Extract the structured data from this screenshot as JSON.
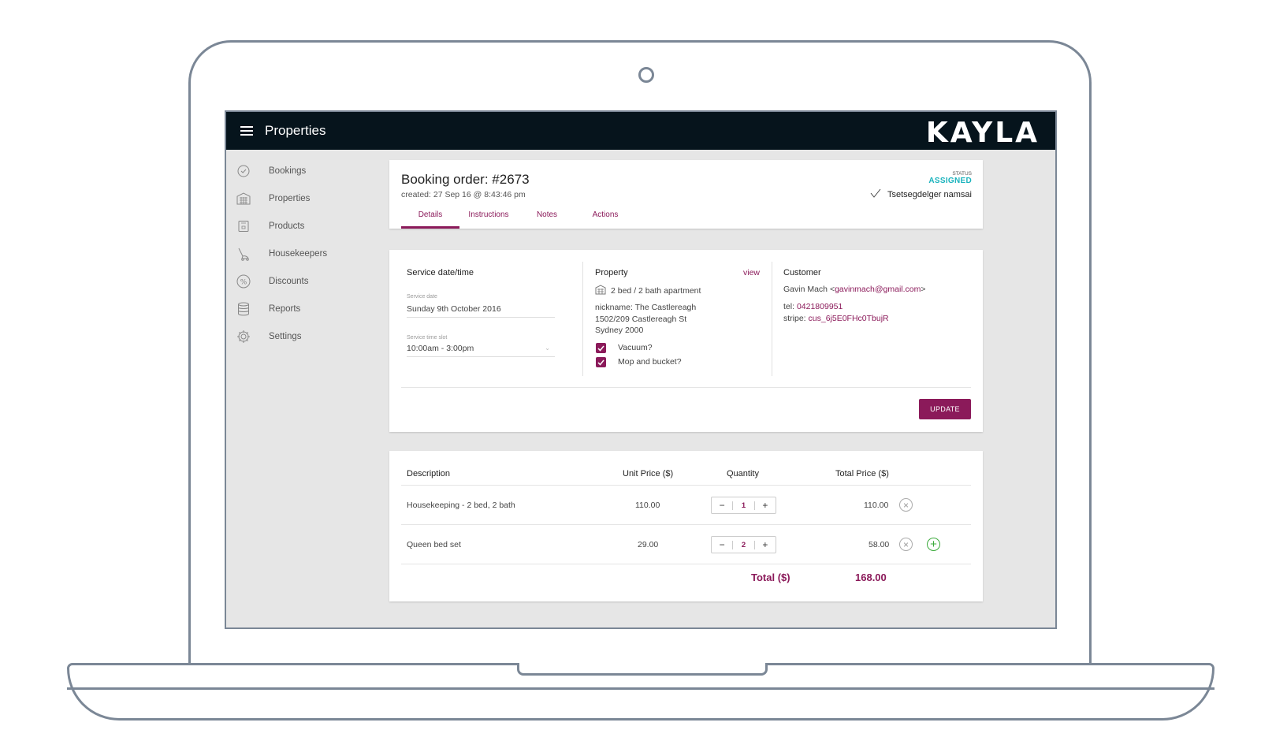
{
  "app": {
    "title": "Properties",
    "logo": "KAYLA"
  },
  "sidebar": {
    "items": [
      {
        "label": "Bookings",
        "icon": "check-circle-icon"
      },
      {
        "label": "Properties",
        "icon": "building-icon"
      },
      {
        "label": "Products",
        "icon": "box-icon"
      },
      {
        "label": "Housekeepers",
        "icon": "vacuum-icon"
      },
      {
        "label": "Discounts",
        "icon": "percent-icon"
      },
      {
        "label": "Reports",
        "icon": "database-icon"
      },
      {
        "label": "Settings",
        "icon": "gear-icon"
      }
    ]
  },
  "order": {
    "title": "Booking order: #2673",
    "created": "created: 27 Sep 16 @ 8:43:46 pm",
    "status_label": "STATUS",
    "status": "ASSIGNED",
    "assignee": "Tsetsegdelger namsai",
    "tabs": [
      "Details",
      "Instructions",
      "Notes",
      "Actions"
    ]
  },
  "details": {
    "service": {
      "title": "Service date/time",
      "date_label": "Service date",
      "date_value": "Sunday 9th October 2016",
      "slot_label": "Service time slot",
      "slot_value": "10:00am - 3:00pm"
    },
    "property": {
      "title": "Property",
      "view_link": "view",
      "type": "2 bed / 2 bath apartment",
      "nickname": "nickname: The Castlereagh",
      "address1": "1502/209 Castlereagh St",
      "address2": "Sydney 2000",
      "vacuum": "Vacuum?",
      "mop": "Mop and bucket?"
    },
    "customer": {
      "title": "Customer",
      "name": "Gavin Mach <",
      "email": "gavinmach@gmail.com",
      "email_close": ">",
      "tel_label": "tel: ",
      "tel": "0421809951",
      "stripe_label": "stripe: ",
      "stripe": "cus_6j5E0FHc0TbujR"
    },
    "update_label": "UPDATE"
  },
  "items": {
    "headers": {
      "description": "Description",
      "unit_price": "Unit Price ($)",
      "quantity": "Quantity",
      "total_price": "Total Price ($)"
    },
    "rows": [
      {
        "description": "Housekeeping - 2 bed, 2 bath",
        "unit_price": "110.00",
        "quantity": "1",
        "total": "110.00"
      },
      {
        "description": "Queen bed set",
        "unit_price": "29.00",
        "quantity": "2",
        "total": "58.00"
      }
    ],
    "total_label": "Total ($)",
    "total_value": "168.00"
  },
  "colors": {
    "accent": "#8b1a5a",
    "status": "#1bb3bd",
    "topbar": "#06141c",
    "add": "#3aaa3a"
  }
}
